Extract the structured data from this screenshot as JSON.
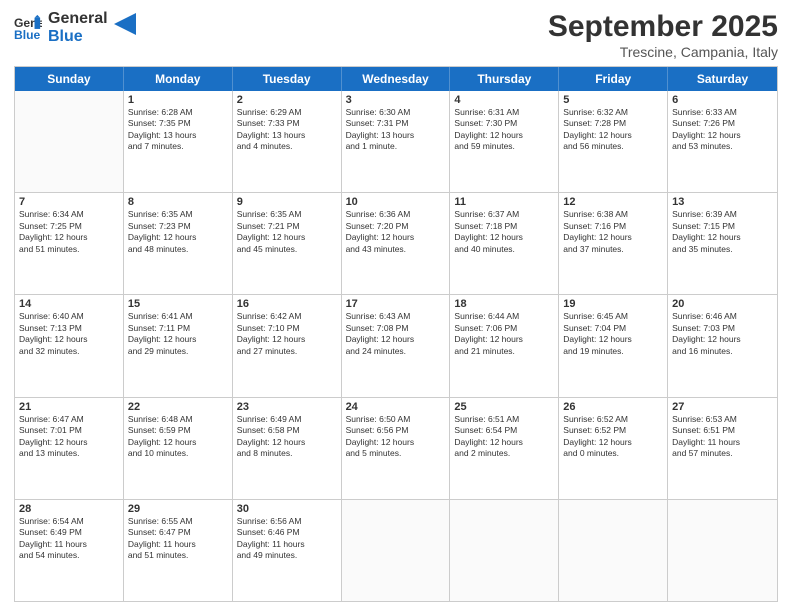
{
  "header": {
    "logo_line1": "General",
    "logo_line2": "Blue",
    "title": "September 2025",
    "subtitle": "Trescine, Campania, Italy"
  },
  "days": [
    "Sunday",
    "Monday",
    "Tuesday",
    "Wednesday",
    "Thursday",
    "Friday",
    "Saturday"
  ],
  "weeks": [
    [
      {
        "day": "",
        "text": ""
      },
      {
        "day": "1",
        "text": "Sunrise: 6:28 AM\nSunset: 7:35 PM\nDaylight: 13 hours\nand 7 minutes."
      },
      {
        "day": "2",
        "text": "Sunrise: 6:29 AM\nSunset: 7:33 PM\nDaylight: 13 hours\nand 4 minutes."
      },
      {
        "day": "3",
        "text": "Sunrise: 6:30 AM\nSunset: 7:31 PM\nDaylight: 13 hours\nand 1 minute."
      },
      {
        "day": "4",
        "text": "Sunrise: 6:31 AM\nSunset: 7:30 PM\nDaylight: 12 hours\nand 59 minutes."
      },
      {
        "day": "5",
        "text": "Sunrise: 6:32 AM\nSunset: 7:28 PM\nDaylight: 12 hours\nand 56 minutes."
      },
      {
        "day": "6",
        "text": "Sunrise: 6:33 AM\nSunset: 7:26 PM\nDaylight: 12 hours\nand 53 minutes."
      }
    ],
    [
      {
        "day": "7",
        "text": "Sunrise: 6:34 AM\nSunset: 7:25 PM\nDaylight: 12 hours\nand 51 minutes."
      },
      {
        "day": "8",
        "text": "Sunrise: 6:35 AM\nSunset: 7:23 PM\nDaylight: 12 hours\nand 48 minutes."
      },
      {
        "day": "9",
        "text": "Sunrise: 6:35 AM\nSunset: 7:21 PM\nDaylight: 12 hours\nand 45 minutes."
      },
      {
        "day": "10",
        "text": "Sunrise: 6:36 AM\nSunset: 7:20 PM\nDaylight: 12 hours\nand 43 minutes."
      },
      {
        "day": "11",
        "text": "Sunrise: 6:37 AM\nSunset: 7:18 PM\nDaylight: 12 hours\nand 40 minutes."
      },
      {
        "day": "12",
        "text": "Sunrise: 6:38 AM\nSunset: 7:16 PM\nDaylight: 12 hours\nand 37 minutes."
      },
      {
        "day": "13",
        "text": "Sunrise: 6:39 AM\nSunset: 7:15 PM\nDaylight: 12 hours\nand 35 minutes."
      }
    ],
    [
      {
        "day": "14",
        "text": "Sunrise: 6:40 AM\nSunset: 7:13 PM\nDaylight: 12 hours\nand 32 minutes."
      },
      {
        "day": "15",
        "text": "Sunrise: 6:41 AM\nSunset: 7:11 PM\nDaylight: 12 hours\nand 29 minutes."
      },
      {
        "day": "16",
        "text": "Sunrise: 6:42 AM\nSunset: 7:10 PM\nDaylight: 12 hours\nand 27 minutes."
      },
      {
        "day": "17",
        "text": "Sunrise: 6:43 AM\nSunset: 7:08 PM\nDaylight: 12 hours\nand 24 minutes."
      },
      {
        "day": "18",
        "text": "Sunrise: 6:44 AM\nSunset: 7:06 PM\nDaylight: 12 hours\nand 21 minutes."
      },
      {
        "day": "19",
        "text": "Sunrise: 6:45 AM\nSunset: 7:04 PM\nDaylight: 12 hours\nand 19 minutes."
      },
      {
        "day": "20",
        "text": "Sunrise: 6:46 AM\nSunset: 7:03 PM\nDaylight: 12 hours\nand 16 minutes."
      }
    ],
    [
      {
        "day": "21",
        "text": "Sunrise: 6:47 AM\nSunset: 7:01 PM\nDaylight: 12 hours\nand 13 minutes."
      },
      {
        "day": "22",
        "text": "Sunrise: 6:48 AM\nSunset: 6:59 PM\nDaylight: 12 hours\nand 10 minutes."
      },
      {
        "day": "23",
        "text": "Sunrise: 6:49 AM\nSunset: 6:58 PM\nDaylight: 12 hours\nand 8 minutes."
      },
      {
        "day": "24",
        "text": "Sunrise: 6:50 AM\nSunset: 6:56 PM\nDaylight: 12 hours\nand 5 minutes."
      },
      {
        "day": "25",
        "text": "Sunrise: 6:51 AM\nSunset: 6:54 PM\nDaylight: 12 hours\nand 2 minutes."
      },
      {
        "day": "26",
        "text": "Sunrise: 6:52 AM\nSunset: 6:52 PM\nDaylight: 12 hours\nand 0 minutes."
      },
      {
        "day": "27",
        "text": "Sunrise: 6:53 AM\nSunset: 6:51 PM\nDaylight: 11 hours\nand 57 minutes."
      }
    ],
    [
      {
        "day": "28",
        "text": "Sunrise: 6:54 AM\nSunset: 6:49 PM\nDaylight: 11 hours\nand 54 minutes."
      },
      {
        "day": "29",
        "text": "Sunrise: 6:55 AM\nSunset: 6:47 PM\nDaylight: 11 hours\nand 51 minutes."
      },
      {
        "day": "30",
        "text": "Sunrise: 6:56 AM\nSunset: 6:46 PM\nDaylight: 11 hours\nand 49 minutes."
      },
      {
        "day": "",
        "text": ""
      },
      {
        "day": "",
        "text": ""
      },
      {
        "day": "",
        "text": ""
      },
      {
        "day": "",
        "text": ""
      }
    ]
  ]
}
